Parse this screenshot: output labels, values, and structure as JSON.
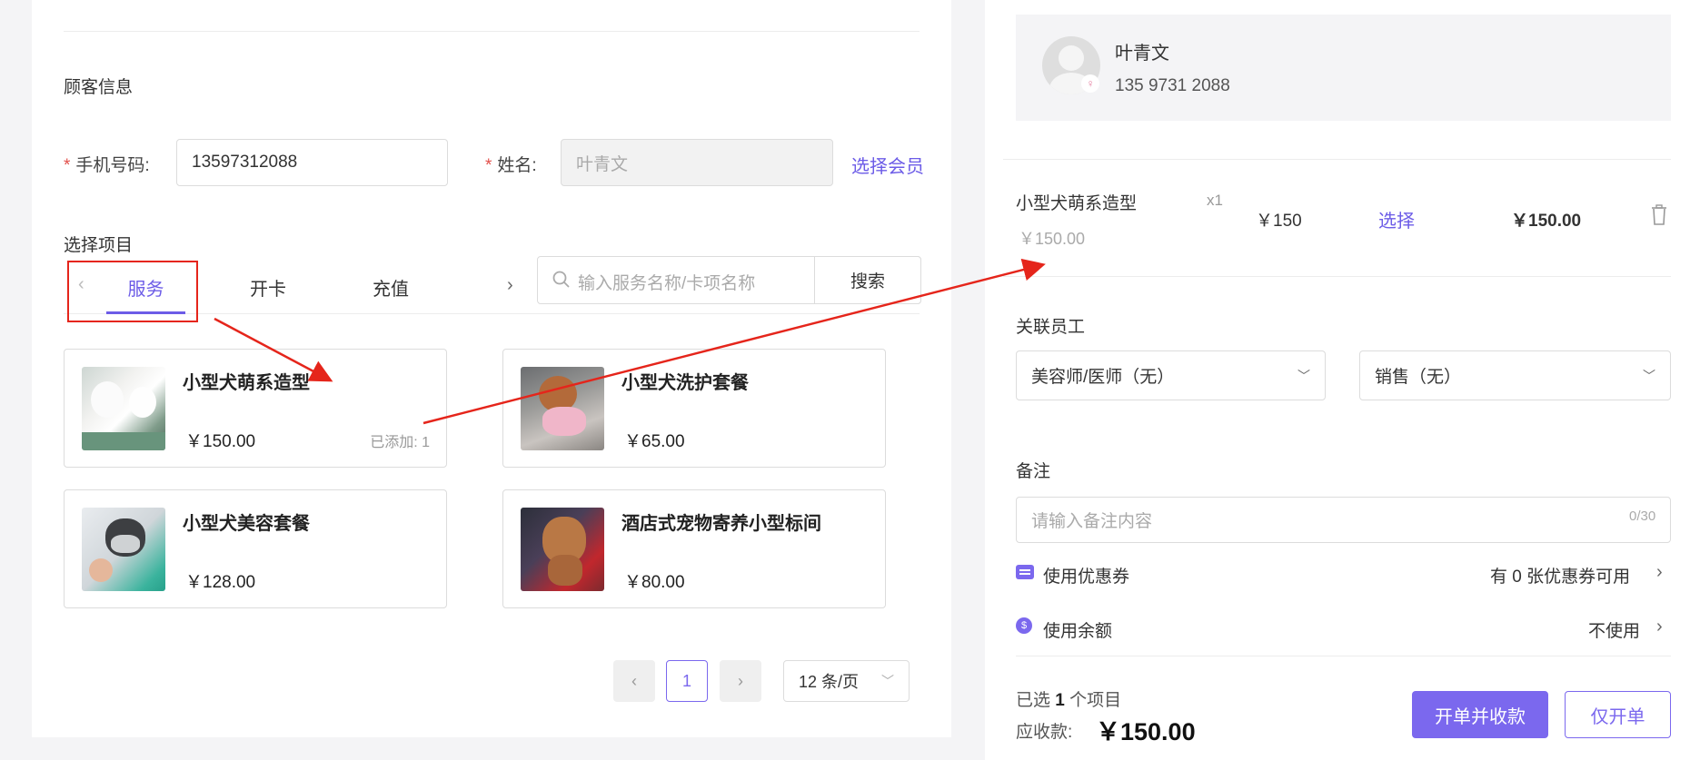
{
  "customer": {
    "section_title": "顾客信息",
    "phone_label": "手机号码:",
    "phone_value": "13597312088",
    "name_label": "姓名:",
    "name_value": "叶青文",
    "select_member": "选择会员",
    "required_mark": "*"
  },
  "items": {
    "section_title": "选择项目",
    "tabs": [
      "服务",
      "开卡",
      "充值"
    ],
    "active_tab": 0,
    "search_placeholder": "输入服务名称/卡项名称",
    "search_button": "搜索",
    "cards": [
      {
        "name": "小型犬萌系造型",
        "price": "￥150.00",
        "added": "已添加: 1"
      },
      {
        "name": "小型犬洗护套餐",
        "price": "￥65.00"
      },
      {
        "name": "小型犬美容套餐",
        "price": "￥128.00"
      },
      {
        "name": "酒店式宠物寄养小型标间",
        "price": "￥80.00"
      }
    ]
  },
  "pagination": {
    "prev": "‹",
    "current": "1",
    "next": "›",
    "page_size": "12 条/页"
  },
  "member": {
    "name": "叶青文",
    "phone": "135 9731 2088"
  },
  "order_line": {
    "name": "小型犬萌系造型",
    "qty": "x1",
    "orig_price": "￥150.00",
    "unit_price": "￥150",
    "select": "选择",
    "total": "￥150.00"
  },
  "staff": {
    "label": "关联员工",
    "groomer": "美容师/医师（无）",
    "sales": "销售（无）"
  },
  "remark": {
    "label": "备注",
    "placeholder": "请输入备注内容",
    "counter": "0/30"
  },
  "coupon": {
    "label": "使用优惠券",
    "value": "有 0 张优惠券可用"
  },
  "balance": {
    "label": "使用余额",
    "value": "不使用"
  },
  "summary": {
    "selected_prefix": "已选",
    "selected_count": "1",
    "selected_suffix": "个项目",
    "due_label": "应收款:",
    "due_amount": "￥150.00"
  },
  "actions": {
    "checkout": "开单并收款",
    "order_only": "仅开单"
  },
  "colors": {
    "accent": "#7b68ee",
    "annotation_red": "#e5251b"
  }
}
